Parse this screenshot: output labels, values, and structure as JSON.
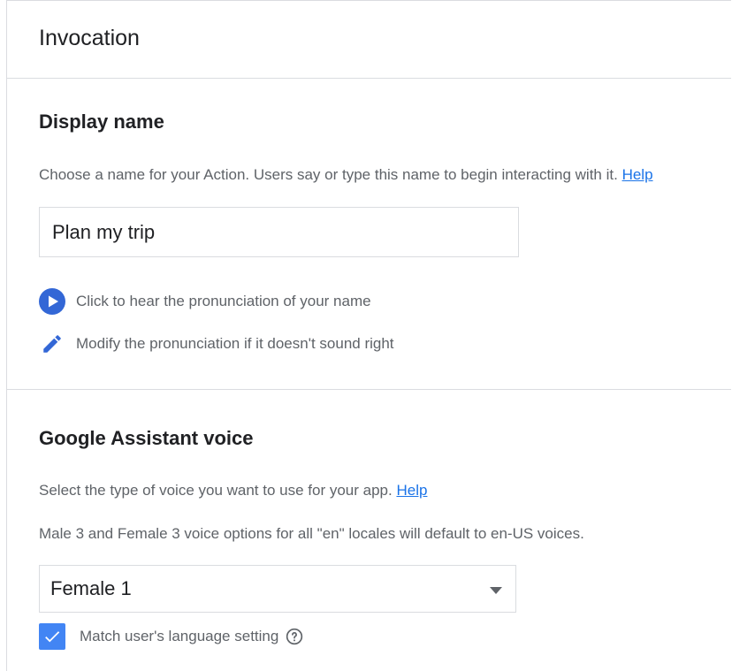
{
  "header": {
    "title": "Invocation"
  },
  "display_name": {
    "title": "Display name",
    "description": "Choose a name for your Action. Users say or type this name to begin interacting with it.",
    "help_link": "Help",
    "input_value": "Plan my trip",
    "hear_pronunciation": "Click to hear the pronunciation of your name",
    "modify_pronunciation": "Modify the pronunciation if it doesn't sound right",
    "play_icon": "play-circle-icon",
    "edit_icon": "pencil-icon"
  },
  "voice": {
    "title": "Google Assistant voice",
    "description": "Select the type of voice you want to use for your app.",
    "help_link": "Help",
    "note": "Male 3 and Female 3 voice options for all \"en\" locales will default to en-US voices.",
    "selected_voice": "Female 1",
    "checkbox_label": "Match user's language setting",
    "checkbox_checked": true,
    "help_icon": "question-circle-icon"
  },
  "colors": {
    "accent": "#4285f4",
    "link": "#1a73e8",
    "play_icon": "#3367d6",
    "text_primary": "#202124",
    "text_secondary": "#5f6368",
    "border": "#dadce0"
  }
}
